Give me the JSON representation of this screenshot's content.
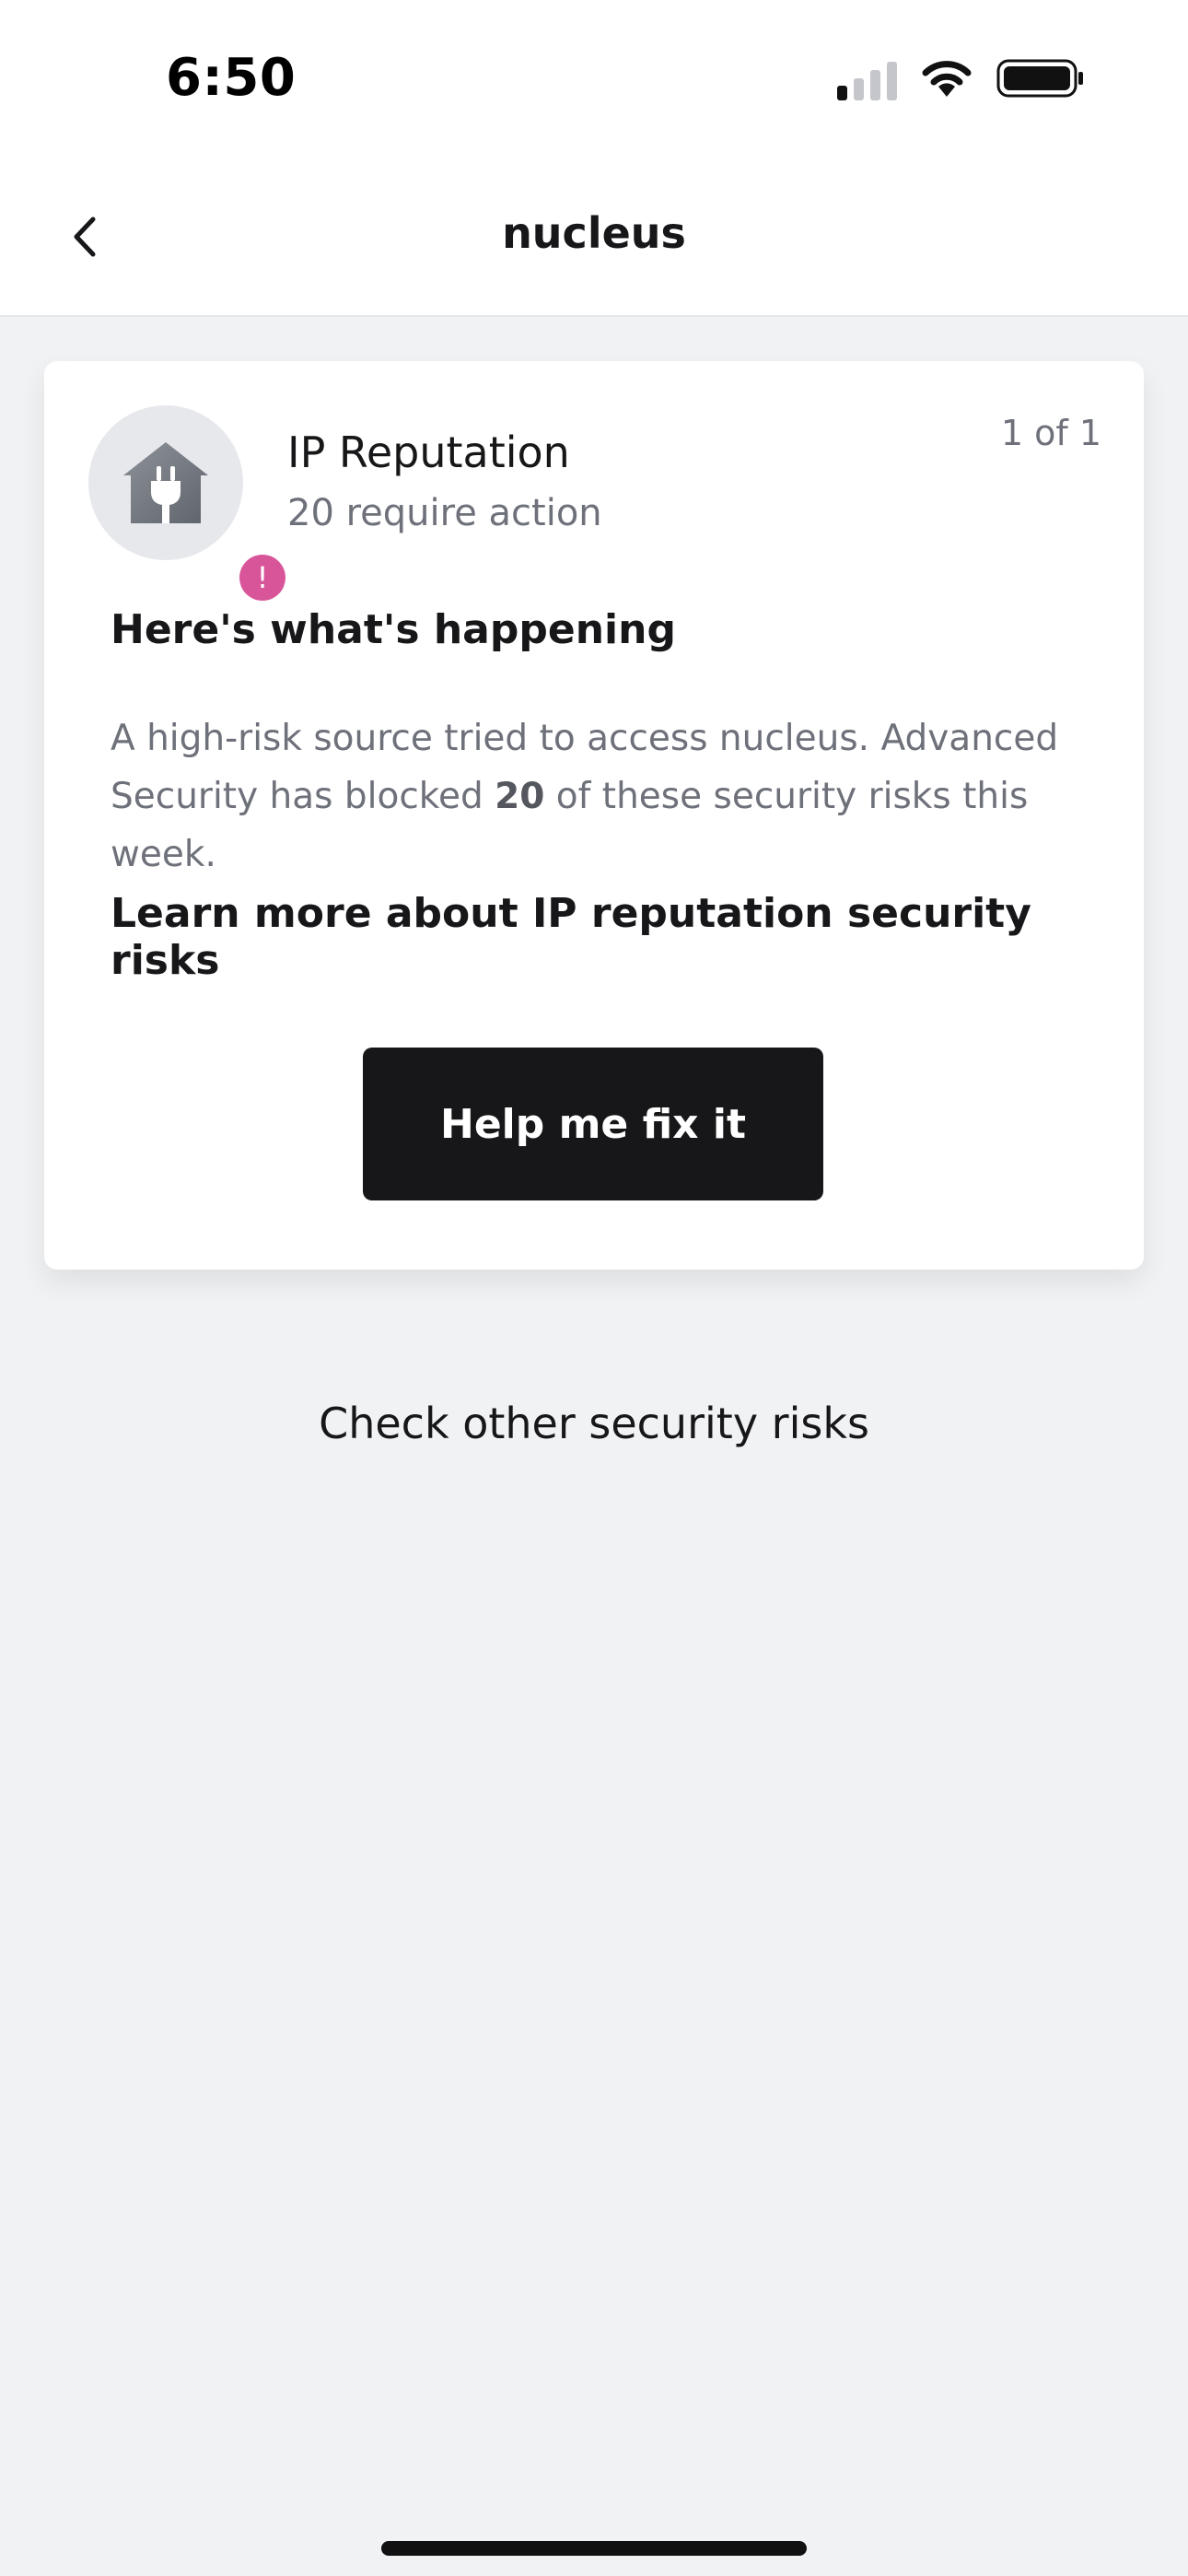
{
  "status_bar": {
    "time": "6:50",
    "icons": [
      "signal-icon",
      "wifi-icon",
      "battery-icon"
    ],
    "signal_bars_active": 1,
    "signal_bars_total": 4
  },
  "nav": {
    "title": "nucleus",
    "back_icon": "chevron-left-icon"
  },
  "card": {
    "icon": "house-plug-icon",
    "badge_icon": "exclamation-icon",
    "badge_text": "!",
    "badge_color": "#d9559a",
    "title": "IP Reputation",
    "subtitle": "20 require action",
    "page_indicator": "1 of 1",
    "section_heading": "Here's what's happening",
    "description_before": "A high-risk source tried to access nucleus. Advanced Security has blocked ",
    "description_count": "20",
    "description_after": " of these security risks this week.",
    "learn_more": "Learn more about IP reputation security risks",
    "primary_button": "Help me fix it"
  },
  "footer": {
    "other_risks_link": "Check other security risks"
  },
  "colors": {
    "background": "#f1f2f4",
    "card": "#ffffff",
    "button": "#17171a",
    "muted_text": "#6e717a"
  }
}
